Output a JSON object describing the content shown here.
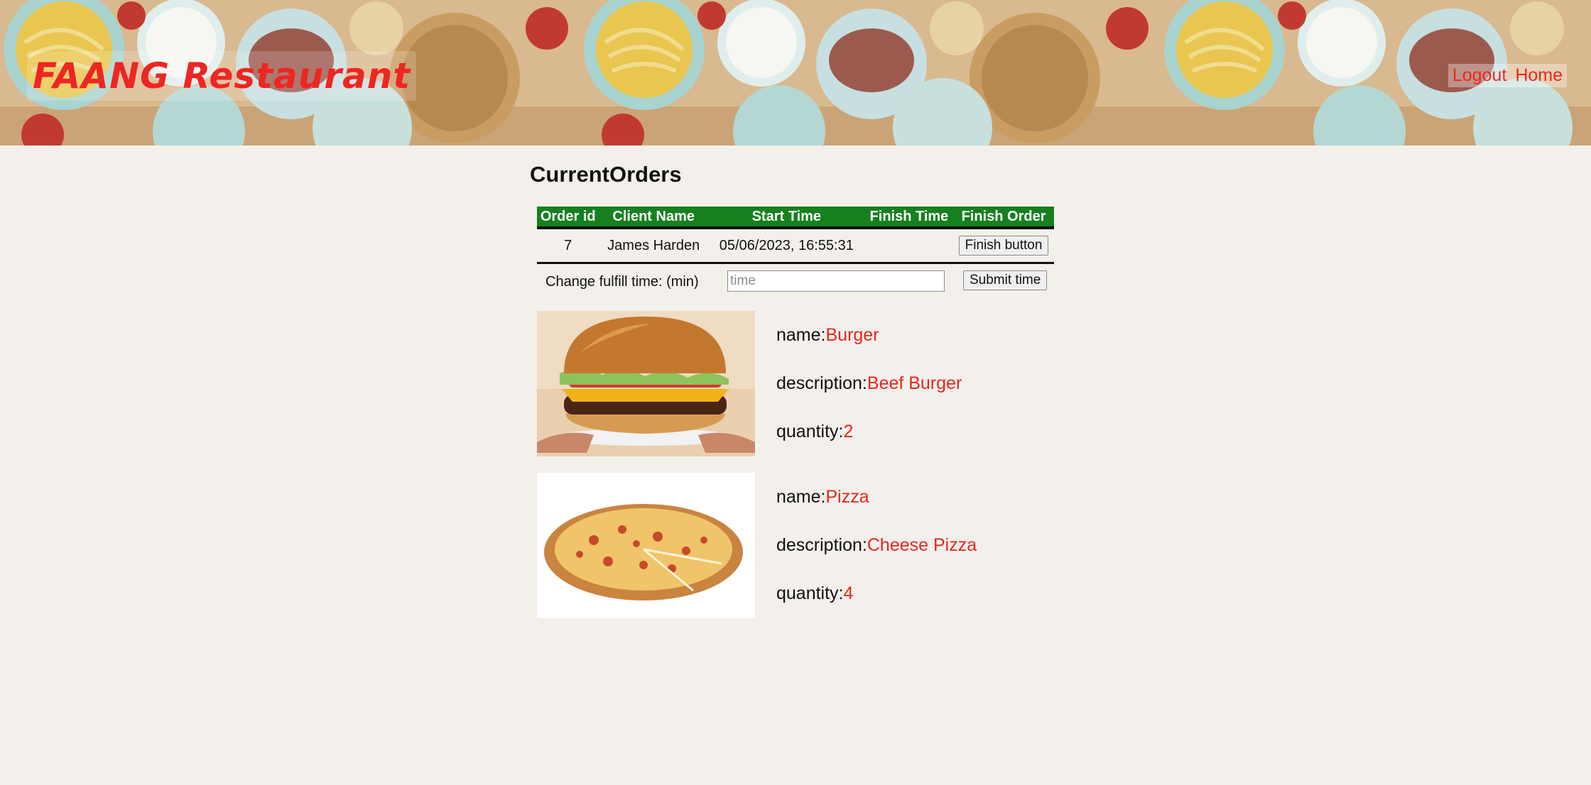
{
  "header": {
    "brand": "FAANG Restaurant",
    "nav": [
      {
        "label": "Logout"
      },
      {
        "label": "Home"
      }
    ],
    "colors": {
      "brand": "#ee2622"
    }
  },
  "main": {
    "title": "CurrentOrders",
    "table": {
      "columns": [
        "Order id",
        "Client Name",
        "Start Time",
        "Finish Time",
        "Finish Order"
      ],
      "rows": [
        {
          "order_id": "7",
          "client_name": "James Harden",
          "start_time": "05/06/2023, 16:55:31",
          "finish_time": "",
          "finish_button": "Finish button"
        }
      ],
      "header_color": "#16801f"
    },
    "fulfill": {
      "label": "Change fulfill time: (min)",
      "placeholder": "time",
      "value": "",
      "submit_label": "Submit time"
    },
    "items": [
      {
        "image": "burger-image",
        "name_label": "name:",
        "name": "Burger",
        "description_label": "description:",
        "description": "Beef Burger",
        "quantity_label": "quantity:",
        "quantity": "2"
      },
      {
        "image": "pizza-image",
        "name_label": "name:",
        "name": "Pizza",
        "description_label": "description:",
        "description": "Cheese Pizza",
        "quantity_label": "quantity:",
        "quantity": "4"
      }
    ],
    "value_color": "#e5261f"
  }
}
